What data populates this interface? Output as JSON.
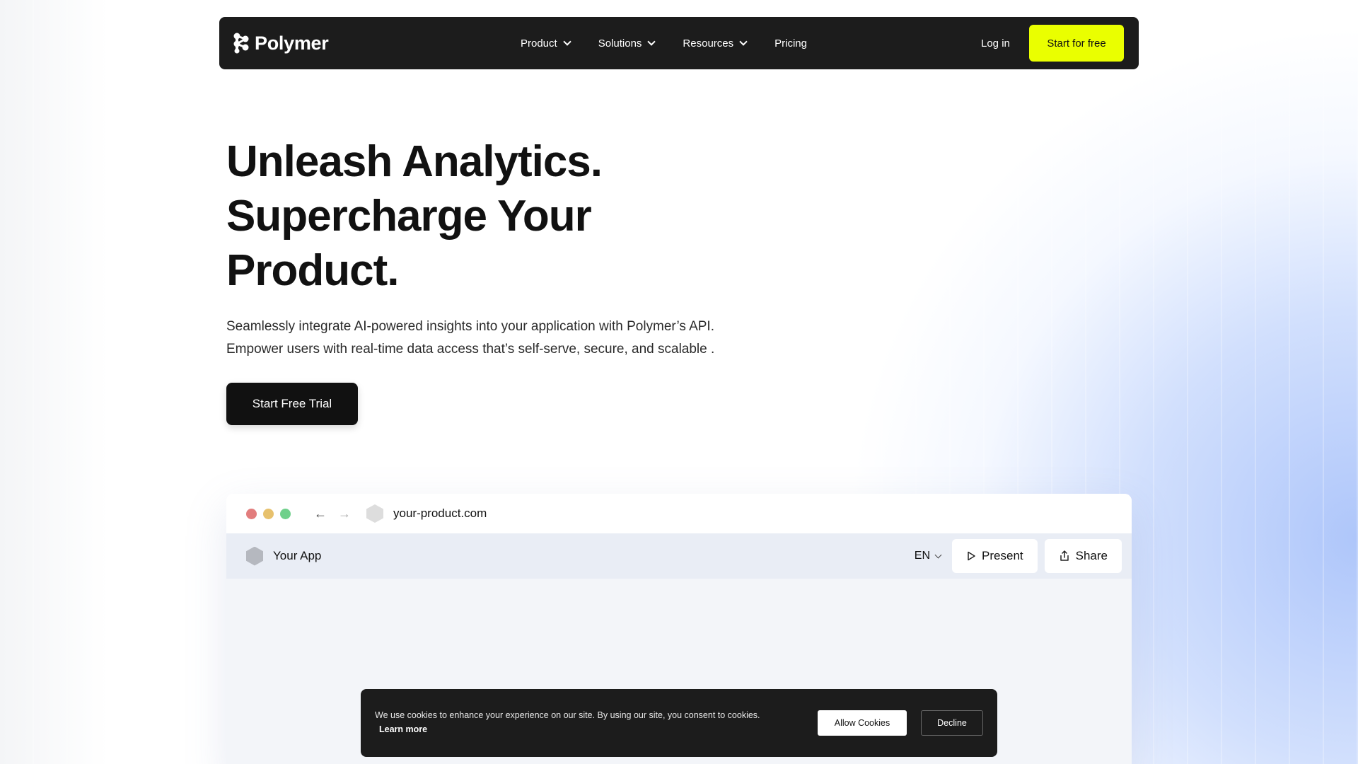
{
  "colors": {
    "accent": "#eaff00",
    "nav_bg": "#1c1c1c",
    "dot_red": "#e27d7d",
    "dot_yellow": "#e7c16d",
    "dot_green": "#6fd08b"
  },
  "nav": {
    "brand": "Polymer",
    "items": [
      {
        "label": "Product",
        "has_dropdown": true
      },
      {
        "label": "Solutions",
        "has_dropdown": true
      },
      {
        "label": "Resources",
        "has_dropdown": true
      },
      {
        "label": "Pricing",
        "has_dropdown": false
      }
    ],
    "login_label": "Log in",
    "cta_label": "Start for free"
  },
  "hero": {
    "title_lines": [
      "Unleash Analytics.",
      "Supercharge Your",
      "Product."
    ],
    "subtitle_lines": [
      "Seamlessly integrate AI-powered insights into your application with Polymer’s API.",
      "Empower users with real-time data access that’s self-serve, secure, and scalable ."
    ],
    "cta_label": "Start Free Trial"
  },
  "browser": {
    "url": "your-product.com",
    "app_name": "Your App",
    "language": "EN",
    "present_label": "Present",
    "share_label": "Share"
  },
  "cookie": {
    "message": "We use cookies to enhance your experience on our site. By using our site, you consent to cookies.",
    "learn_more": "Learn more",
    "allow_label": "Allow Cookies",
    "decline_label": "Decline"
  }
}
